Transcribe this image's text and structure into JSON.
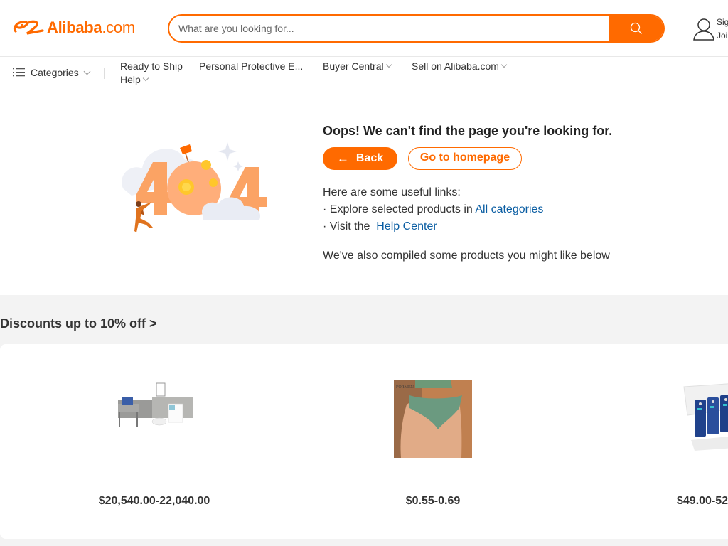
{
  "header": {
    "logo_text": "Alibaba",
    "logo_suffix": ".com",
    "search_placeholder": "What are you looking for...",
    "search_value": "",
    "account_sign_in": "Sign in",
    "account_join": "Join Free"
  },
  "nav": {
    "categories_label": "Categories",
    "items": [
      {
        "label": "Ready to Ship",
        "has_dropdown": false
      },
      {
        "label": "Personal Protective E...",
        "has_dropdown": false
      },
      {
        "label": "Buyer Central",
        "has_dropdown": true
      },
      {
        "label": "Sell on Alibaba.com",
        "has_dropdown": true
      },
      {
        "label": "Help",
        "has_dropdown": true
      }
    ]
  },
  "error": {
    "illustration": "404-moon-illustration",
    "title": "Oops! We can't find the page you're looking for.",
    "back_label": "Back",
    "home_label": "Go to homepage",
    "links_intro": "Here are some useful links:",
    "link1_prefix": "· Explore selected products in",
    "link1_label": "All categories",
    "link2_prefix": "· Visit the",
    "link2_label": "Help Center",
    "also_text": "We've also compiled some products you might like below"
  },
  "discounts": {
    "title": "Discounts up to 10% off >",
    "products": [
      {
        "image": "mask-packing-machine",
        "price": "$20,540.00-22,040.00"
      },
      {
        "image": "green-underwear",
        "price": "$0.55-0.69"
      },
      {
        "image": "blue-battery-cells",
        "price": "$49.00-52"
      }
    ]
  },
  "colors": {
    "brand": "#ff6a00",
    "link": "#0b5ea3",
    "section_bg": "#f3f3f3"
  }
}
